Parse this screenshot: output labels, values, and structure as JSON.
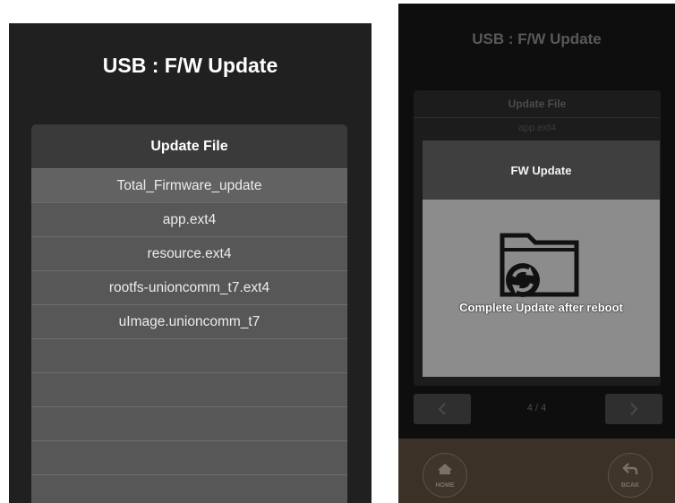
{
  "left": {
    "title": "USB : F/W Update",
    "panel_header": "Update File",
    "files": [
      "Total_Firmware_update",
      "app.ext4",
      "resource.ext4",
      "rootfs-unioncomm_t7.ext4",
      "uImage.unioncomm_t7",
      "",
      "",
      "",
      "",
      ""
    ]
  },
  "right": {
    "title": "USB : F/W Update",
    "panel_header": "Update File",
    "panel_first_row": "app.ext4",
    "dialog": {
      "title": "FW Update",
      "icon": "folder-update-icon",
      "message": "Complete Update after reboot"
    },
    "page_indicator": "4 / 4",
    "prev_icon": "chevron-left-icon",
    "next_icon": "chevron-right-icon",
    "home_label": "HOME",
    "back_label": "BCAK"
  },
  "colors": {
    "screen_bg": "#202020",
    "panel_row": "#575757",
    "panel_header": "#3a3a3a",
    "dialog_body": "#8c8c8c",
    "bottom_bar": "#3b3126"
  }
}
